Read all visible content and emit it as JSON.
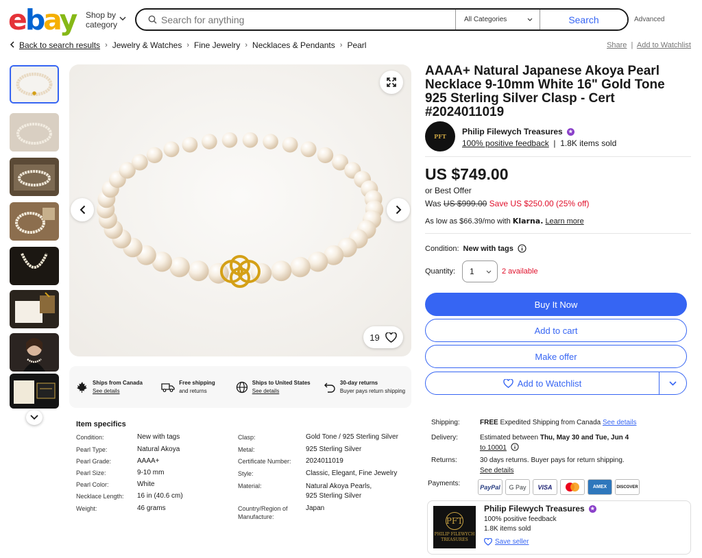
{
  "header": {
    "logo_letters": [
      "e",
      "b",
      "a",
      "y"
    ],
    "shop_by_label": "Shop by\ncategory",
    "search_placeholder": "Search for anything",
    "category_label": "All Categories",
    "search_button": "Search",
    "advanced_link": "Advanced"
  },
  "breadcrumb": {
    "back": "Back to search results",
    "items": [
      "Jewelry & Watches",
      "Fine Jewelry",
      "Necklaces & Pendants",
      "Pearl"
    ],
    "share": "Share",
    "watchlist": "Add to Watchlist"
  },
  "gallery": {
    "thumbnail_count": 8,
    "watch_count": "19"
  },
  "shipping_strip": [
    {
      "title": "Ships from Canada",
      "sub": "See details",
      "icon": "maple-leaf-icon",
      "sub_link": true
    },
    {
      "title": "Free shipping",
      "sub": "and returns",
      "icon": "truck-icon",
      "sub_link": false
    },
    {
      "title": "Ships to United States",
      "sub": "See details",
      "icon": "globe-icon",
      "sub_link": true
    },
    {
      "title": "30-day returns",
      "sub": "Buyer pays return shipping",
      "icon": "return-arrow-icon",
      "sub_link": false
    }
  ],
  "specifics": {
    "heading": "Item specifics",
    "left": [
      {
        "label": "Condition:",
        "value": "New with tags"
      },
      {
        "label": "Pearl Type:",
        "value": "Natural Akoya"
      },
      {
        "label": "Pearl Grade:",
        "value": "AAAA+"
      },
      {
        "label": "Pearl Size:",
        "value": "9-10 mm"
      },
      {
        "label": "Pearl Color:",
        "value": "White"
      },
      {
        "label": "Necklace Length:",
        "value": "16 in (40.6 cm)"
      },
      {
        "label": "Weight:",
        "value": "46 grams"
      }
    ],
    "right": [
      {
        "label": "Clasp:",
        "value": "Gold Tone / 925 Sterling Silver"
      },
      {
        "label": "Metal:",
        "value": "925 Sterling Silver"
      },
      {
        "label": "Certificate Number:",
        "value": "2024011019"
      },
      {
        "label": "Style:",
        "value": "Classic, Elegant, Fine Jewelry"
      },
      {
        "label": "Material:",
        "value": "Natural Akoya Pearls,\n925 Sterling Silver"
      },
      {
        "label": "Country/Region of\nManufacture:",
        "value": "Japan"
      }
    ]
  },
  "listing": {
    "title": "AAAA+ Natural Japanese Akoya Pearl Necklace 9-10mm White 16\" Gold Tone 925 Sterling Silver Clasp - Cert #2024011019",
    "seller_name": "Philip Filewych Treasures",
    "seller_feedback": "100% positive feedback",
    "items_sold": "1.8K items sold",
    "seller_logo_text": "PFT",
    "price": "US $749.00",
    "best_offer": "or Best Offer",
    "was_label": "Was",
    "was_price": "US $999.00",
    "save_text": "Save US $250.00 (25% off)",
    "klarna_prefix": "As low as $66.39/mo with",
    "klarna_brand": "Klarna.",
    "klarna_link": "Learn more",
    "condition_label": "Condition:",
    "condition_value": "New with tags",
    "quantity_label": "Quantity:",
    "quantity_value": "1",
    "available": "2 available",
    "buy_now": "Buy It Now",
    "add_cart": "Add to cart",
    "make_offer": "Make offer",
    "add_watchlist": "Add to Watchlist"
  },
  "delivery": {
    "shipping_label": "Shipping:",
    "shipping_free": "FREE",
    "shipping_text": "Expedited Shipping from Canada",
    "shipping_link": "See details",
    "delivery_label": "Delivery:",
    "delivery_prefix": "Estimated between",
    "delivery_dates": "Thu, May 30 and Tue, Jun 4",
    "delivery_to": "to 10001",
    "returns_label": "Returns:",
    "returns_text": "30 days returns. Buyer pays for return shipping.",
    "returns_link": "See details",
    "payments_label": "Payments:",
    "payments": [
      "PayPal",
      "G Pay",
      "VISA",
      "mastercard-icon",
      "AMEX",
      "DISCOVER"
    ]
  },
  "seller_card": {
    "name": "Philip Filewych Treasures",
    "feedback": "100% positive feedback",
    "sold": "1.8K items sold",
    "save_seller": "Save seller",
    "logo_lines": [
      "PFT",
      "PHILIP FILEWYCH",
      "TREASURES"
    ]
  },
  "colors": {
    "accent": "#3665f3",
    "sale_red": "#e0102b",
    "gold": "#d4a017"
  }
}
